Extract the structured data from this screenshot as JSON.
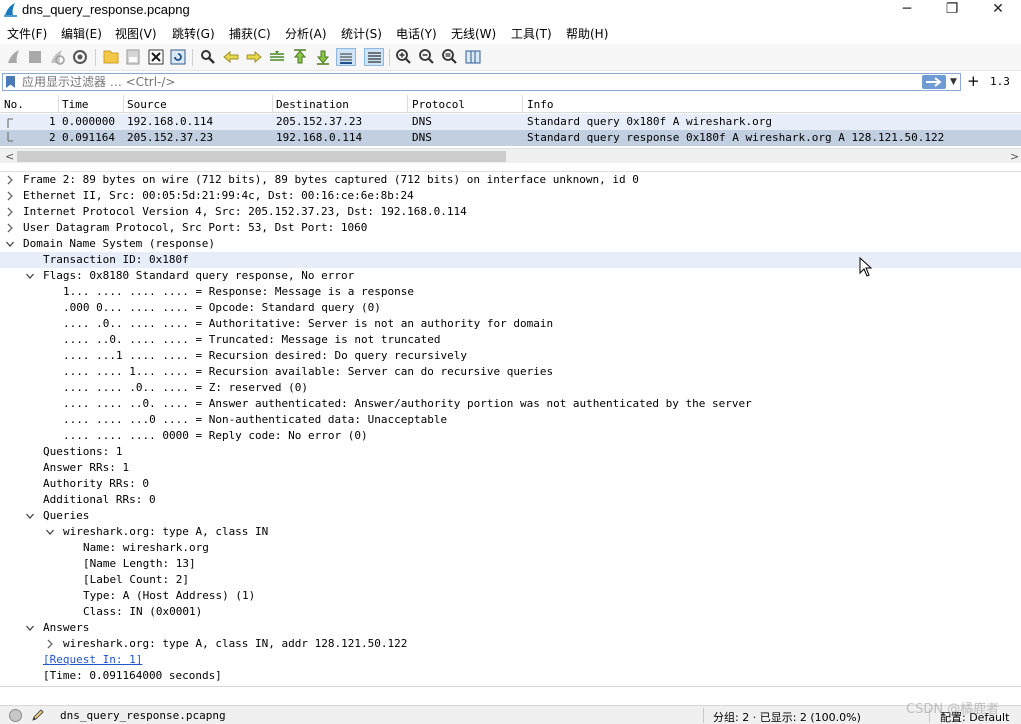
{
  "window": {
    "title": "dns_query_response.pcapng",
    "minimize": "─",
    "maximize": "❐",
    "close": "✕"
  },
  "menu": [
    "文件(F)",
    "编辑(E)",
    "视图(V)",
    "跳转(G)",
    "捕获(C)",
    "分析(A)",
    "统计(S)",
    "电话(Y)",
    "无线(W)",
    "工具(T)",
    "帮助(H)"
  ],
  "filter": {
    "placeholder": "应用显示过滤器 … <Ctrl-/>",
    "version": "1.3",
    "plus": "+"
  },
  "packet_list": {
    "columns": [
      "No.",
      "Time",
      "Source",
      "Destination",
      "Protocol",
      "Info"
    ],
    "rows": [
      {
        "no": "1",
        "time": "0.000000",
        "source": "192.168.0.114",
        "destination": "205.152.37.23",
        "protocol": "DNS",
        "info": "Standard query 0x180f A wireshark.org"
      },
      {
        "no": "2",
        "time": "0.091164",
        "source": "205.152.37.23",
        "destination": "192.168.0.114",
        "protocol": "DNS",
        "info": "Standard query response 0x180f A wireshark.org A 128.121.50.122"
      }
    ]
  },
  "details": [
    {
      "text": "Frame 2: 89 bytes on wire (712 bits), 89 bytes captured (712 bits) on interface unknown, id 0",
      "level": 0,
      "expander": "collapsed"
    },
    {
      "text": "Ethernet II, Src: 00:05:5d:21:99:4c, Dst: 00:16:ce:6e:8b:24",
      "level": 0,
      "expander": "collapsed"
    },
    {
      "text": "Internet Protocol Version 4, Src: 205.152.37.23, Dst: 192.168.0.114",
      "level": 0,
      "expander": "collapsed"
    },
    {
      "text": "User Datagram Protocol, Src Port: 53, Dst Port: 1060",
      "level": 0,
      "expander": "collapsed"
    },
    {
      "text": "Domain Name System (response)",
      "level": 0,
      "expander": "expanded"
    },
    {
      "text": "Transaction ID: 0x180f",
      "level": 1,
      "expander": "none",
      "selected": true
    },
    {
      "text": "Flags: 0x8180 Standard query response, No error",
      "level": 1,
      "expander": "expanded"
    },
    {
      "text": "1... .... .... .... = Response: Message is a response",
      "level": 2,
      "expander": "none"
    },
    {
      "text": ".000 0... .... .... = Opcode: Standard query (0)",
      "level": 2,
      "expander": "none"
    },
    {
      "text": ".... .0.. .... .... = Authoritative: Server is not an authority for domain",
      "level": 2,
      "expander": "none"
    },
    {
      "text": ".... ..0. .... .... = Truncated: Message is not truncated",
      "level": 2,
      "expander": "none"
    },
    {
      "text": ".... ...1 .... .... = Recursion desired: Do query recursively",
      "level": 2,
      "expander": "none"
    },
    {
      "text": ".... .... 1... .... = Recursion available: Server can do recursive queries",
      "level": 2,
      "expander": "none"
    },
    {
      "text": ".... .... .0.. .... = Z: reserved (0)",
      "level": 2,
      "expander": "none"
    },
    {
      "text": ".... .... ..0. .... = Answer authenticated: Answer/authority portion was not authenticated by the server",
      "level": 2,
      "expander": "none"
    },
    {
      "text": ".... .... ...0 .... = Non-authenticated data: Unacceptable",
      "level": 2,
      "expander": "none"
    },
    {
      "text": ".... .... .... 0000 = Reply code: No error (0)",
      "level": 2,
      "expander": "none"
    },
    {
      "text": "Questions: 1",
      "level": 1,
      "expander": "none"
    },
    {
      "text": "Answer RRs: 1",
      "level": 1,
      "expander": "none"
    },
    {
      "text": "Authority RRs: 0",
      "level": 1,
      "expander": "none"
    },
    {
      "text": "Additional RRs: 0",
      "level": 1,
      "expander": "none"
    },
    {
      "text": "Queries",
      "level": 1,
      "expander": "expanded"
    },
    {
      "text": "wireshark.org: type A, class IN",
      "level": 2,
      "expander": "expanded"
    },
    {
      "text": "Name: wireshark.org",
      "level": 3,
      "expander": "none"
    },
    {
      "text": "[Name Length: 13]",
      "level": 3,
      "expander": "none"
    },
    {
      "text": "[Label Count: 2]",
      "level": 3,
      "expander": "none"
    },
    {
      "text": "Type: A (Host Address) (1)",
      "level": 3,
      "expander": "none"
    },
    {
      "text": "Class: IN (0x0001)",
      "level": 3,
      "expander": "none"
    },
    {
      "text": "Answers",
      "level": 1,
      "expander": "expanded"
    },
    {
      "text": "wireshark.org: type A, class IN, addr 128.121.50.122",
      "level": 2,
      "expander": "collapsed"
    },
    {
      "text": "[Request In: 1]",
      "level": 1,
      "expander": "none",
      "link": true
    },
    {
      "text": "[Time: 0.091164000 seconds]",
      "level": 1,
      "expander": "none"
    }
  ],
  "status": {
    "file": "dns_query_response.pcapng",
    "packets": "分组: 2 · 已显示: 2 (100.0%)",
    "profile": "配置: Default"
  },
  "watermark": "CSDN @橘鹿者"
}
